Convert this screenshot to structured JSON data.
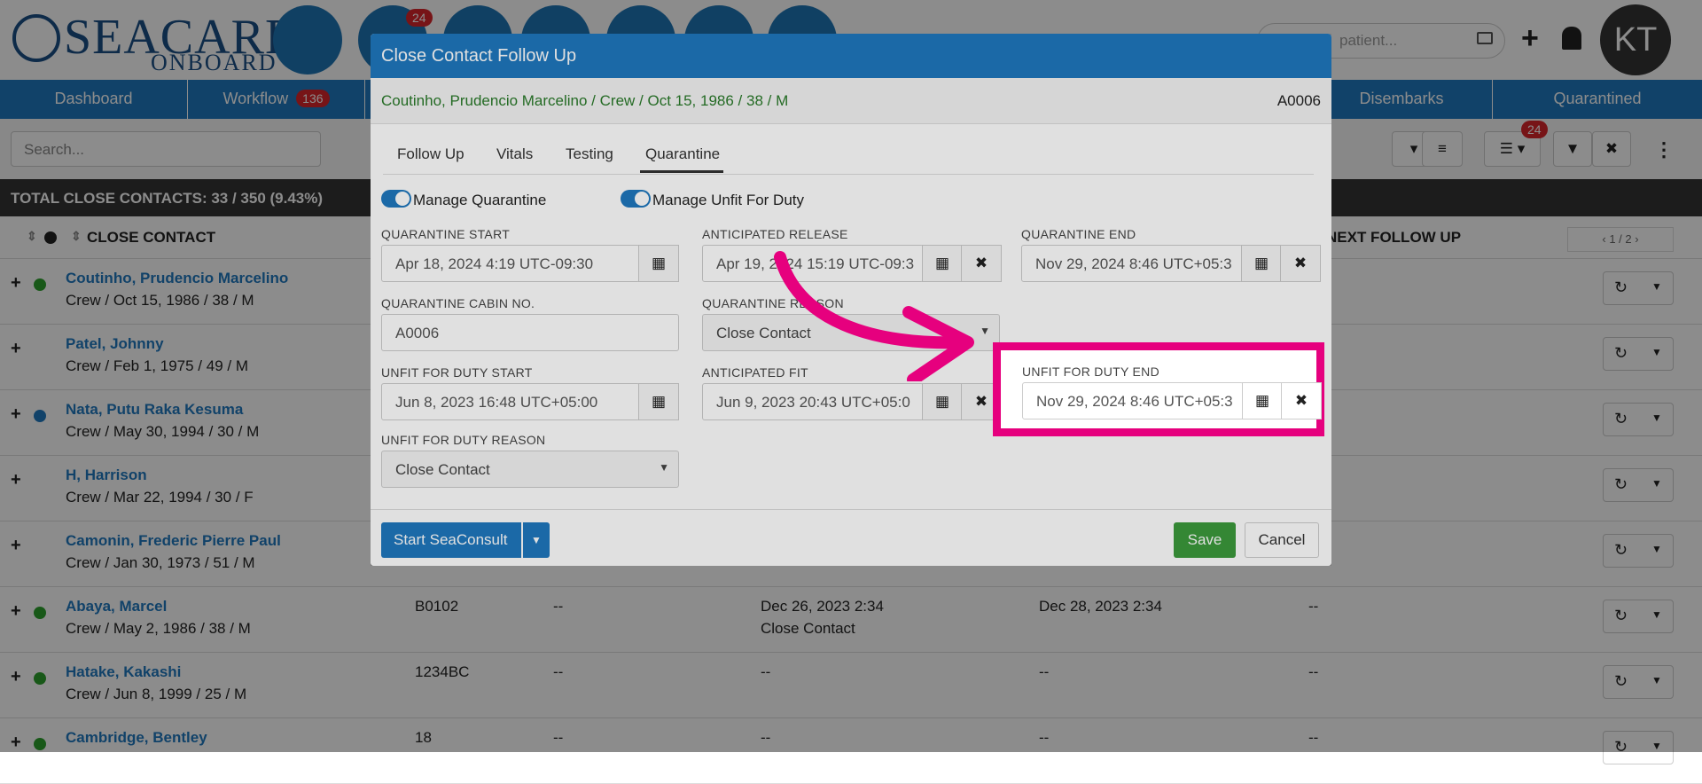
{
  "header": {
    "logo_sea": "SEACARE",
    "logo_onboard": "ONBOARD",
    "notif_badge": "24",
    "search_placeholder": "patient...",
    "avatar_initials": "KT"
  },
  "tabs": {
    "dashboard": "Dashboard",
    "workflow": "Workflow",
    "workflow_count": "136",
    "disembarks": "Disembarks",
    "quarantined": "Quarantined"
  },
  "filter": {
    "search_placeholder": "Search...",
    "list_badge": "24"
  },
  "total_label": "TOTAL CLOSE CONTACTS: 33 / 350 (9.43%)",
  "table": {
    "col_close_contact": "CLOSE CONTACT",
    "col_next_follow_up": "NEXT FOLLOW UP",
    "pager": "1 / 2",
    "rows": [
      {
        "name": "Coutinho, Prudencio Marcelino",
        "sub": "Crew / Oct 15, 1986 / 38 / M",
        "dot": "#2ca02c"
      },
      {
        "name": "Patel, Johnny",
        "sub": "Crew / Feb 1, 1975 / 49 / M",
        "dot": ""
      },
      {
        "name": "Nata, Putu Raka Kesuma",
        "sub": "Crew / May 30, 1994 / 30 / M",
        "dot": "#1f78bf"
      },
      {
        "name": "H, Harrison",
        "sub": "Crew / Mar 22, 1994 / 30 / F",
        "dot": ""
      },
      {
        "name": "Camonin, Frederic Pierre Paul",
        "sub": "Crew / Jan 30, 1973 / 51 / M",
        "dot": ""
      },
      {
        "name": "Abaya, Marcel",
        "sub": "Crew / May 2, 1986 / 38 / M",
        "dot": "#2ca02c",
        "cabin": "B0102",
        "c2": "--",
        "c3": "Dec 26, 2023 2:34",
        "c3b": "Close Contact",
        "c4": "Dec 28, 2023 2:34",
        "c5": "--"
      },
      {
        "name": "Hatake, Kakashi",
        "sub": "Crew / Jun 8, 1999 / 25 / M",
        "dot": "#2ca02c",
        "cabin": "1234BC",
        "c2": "--",
        "c3": "--",
        "c4": "--",
        "c5": "--"
      },
      {
        "name": "Cambridge, Bentley",
        "sub": "",
        "dot": "#2ca02c",
        "cabin": "18",
        "c2": "--",
        "c3": "--",
        "c4": "--",
        "c5": "--"
      }
    ]
  },
  "modal": {
    "title": "Close Contact Follow Up",
    "patient": "Coutinho, Prudencio Marcelino / Crew / Oct 15, 1986 / 38 / M",
    "patient_id": "A0006",
    "tabs": [
      "Follow Up",
      "Vitals",
      "Testing",
      "Quarantine"
    ],
    "active_tab": "Quarantine",
    "toggle_quarantine": "Manage Quarantine",
    "toggle_unfit": "Manage Unfit For Duty",
    "quarantine_start_label": "QUARANTINE START",
    "quarantine_start": "Apr 18, 2024 4:19 UTC-09:30",
    "anticipated_release_label": "ANTICIPATED RELEASE",
    "anticipated_release": "Apr 19, 2024 15:19 UTC-09:3",
    "quarantine_end_label": "QUARANTINE END",
    "quarantine_end": "Nov 29, 2024 8:46 UTC+05:3",
    "cabin_label": "QUARANTINE CABIN NO.",
    "cabin": "A0006",
    "reason_label": "QUARANTINE REASON",
    "reason": "Close Contact",
    "unfit_start_label": "UNFIT FOR DUTY START",
    "unfit_start": "Jun 8, 2023 16:48 UTC+05:00",
    "anticipated_fit_label": "ANTICIPATED FIT",
    "anticipated_fit": "Jun 9, 2023 20:43 UTC+05:0",
    "unfit_end_label": "UNFIT FOR DUTY END",
    "unfit_end": "Nov 29, 2024 8:46 UTC+05:3",
    "unfit_reason_label": "UNFIT FOR DUTY REASON",
    "unfit_reason": "Close Contact",
    "start_seaconsult": "Start SeaConsult",
    "save": "Save",
    "cancel": "Cancel"
  },
  "colors": {
    "brand_blue": "#1f78bf",
    "highlight": "#e6007e",
    "save_green": "#3c9a3c"
  }
}
